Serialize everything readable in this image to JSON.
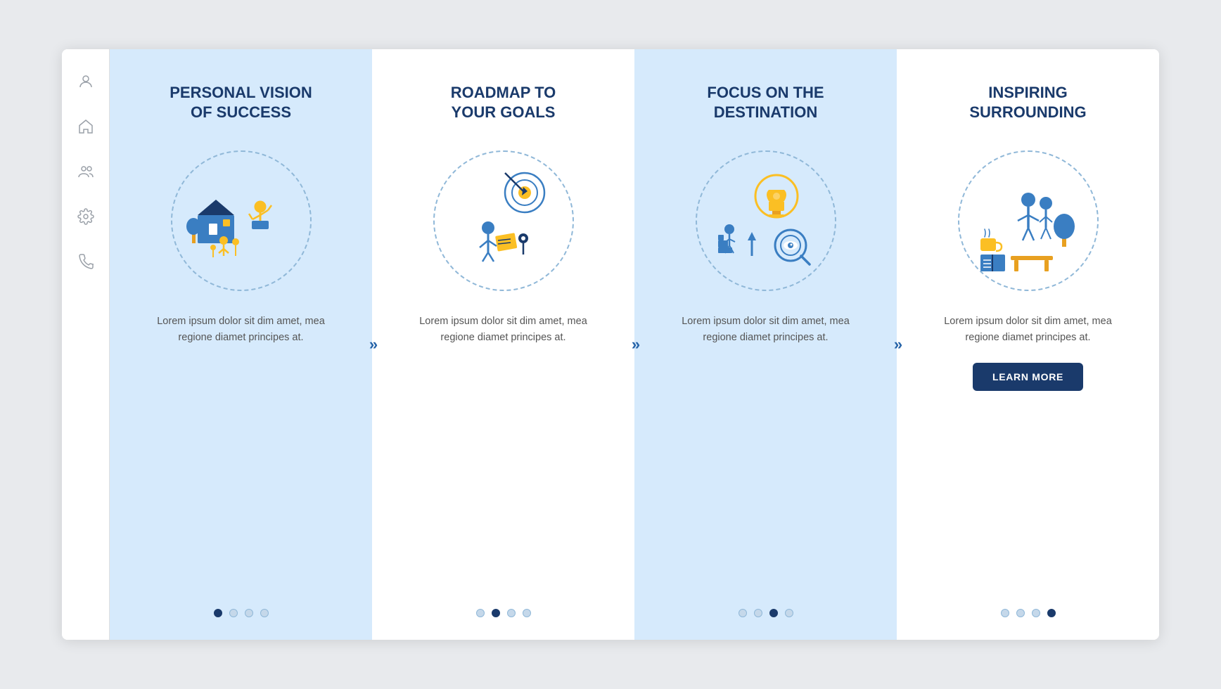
{
  "sidebar": {
    "icons": [
      "user-icon",
      "home-icon",
      "team-icon",
      "gear-icon",
      "phone-icon"
    ]
  },
  "panels": [
    {
      "id": "panel-1",
      "title": "PERSONAL VISION\nOF SUCCESS",
      "body_text": "Lorem ipsum dolor sit dim amet, mea regione diamet principes at.",
      "dots": [
        true,
        false,
        false,
        false
      ],
      "bg": "blue",
      "has_arrow": true
    },
    {
      "id": "panel-2",
      "title": "ROADMAP TO\nYOUR GOALS",
      "body_text": "Lorem ipsum dolor sit dim amet, mea regione diamet principes at.",
      "dots": [
        false,
        true,
        false,
        false
      ],
      "bg": "white",
      "has_arrow": true
    },
    {
      "id": "panel-3",
      "title": "FOCUS ON THE\nDESTINATION",
      "body_text": "Lorem ipsum dolor sit dim amet, mea regione diamet principes at.",
      "dots": [
        false,
        false,
        true,
        false
      ],
      "bg": "blue",
      "has_arrow": true
    },
    {
      "id": "panel-4",
      "title": "INSPIRING\nSURROUNDING",
      "body_text": "Lorem ipsum dolor sit dim amet, mea regione diamet principes at.",
      "dots": [
        false,
        false,
        false,
        true
      ],
      "bg": "white",
      "has_arrow": false,
      "has_button": true,
      "button_label": "LEARN MORE"
    }
  ]
}
